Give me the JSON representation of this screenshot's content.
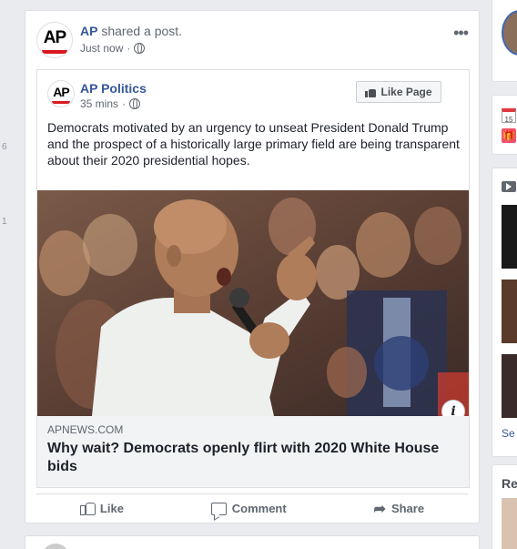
{
  "left_rail": {
    "num_top": "6",
    "num_bottom": "1"
  },
  "post": {
    "author": "AP",
    "action_text": "shared a post.",
    "time": "Just now",
    "more_label": "•••",
    "logo_text": "AP",
    "shared": {
      "page_name": "AP Politics",
      "time": "35 mins",
      "like_page_label": "Like Page",
      "text": "Democrats motivated by an urgency to unseat President Donald Trump and the prospect of a historically large primary field are being transparent about their 2020 presidential hopes.",
      "link": {
        "domain": "apnews.com",
        "title": "Why wait? Democrats openly flirt with 2020 White House bids",
        "info_label": "i"
      }
    },
    "actions": [
      {
        "label": "Like",
        "icon": "thumbs-up-icon"
      },
      {
        "label": "Comment",
        "icon": "comment-icon"
      },
      {
        "label": "Share",
        "icon": "share-arrow-icon"
      }
    ]
  },
  "right_rail": {
    "calendar_day": "15",
    "gift_glyph": "🎁",
    "see_text": "Se",
    "rec_text": "Re"
  },
  "colors": {
    "link_blue": "#365899",
    "ap_red": "#d71920",
    "background": "#e9ebee"
  }
}
